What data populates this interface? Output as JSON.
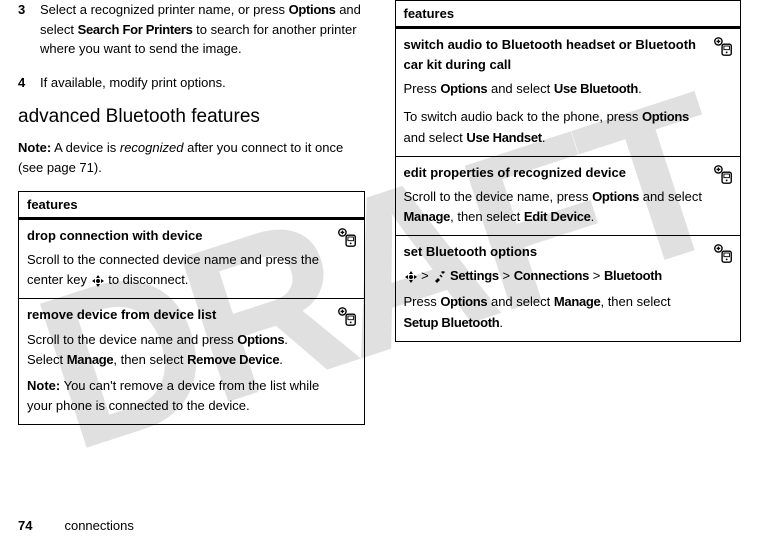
{
  "watermark": "DRAFT",
  "left": {
    "step3_num": "3",
    "step3_a": "Select a recognized printer name, or press ",
    "step3_options": "Options",
    "step3_b": " and select ",
    "step3_search": "Search For Printers",
    "step3_c": " to search for another printer where you want to send the image.",
    "step4_num": "4",
    "step4_text": "If available, modify print options.",
    "heading": "advanced Bluetooth features",
    "note_prefix": "Note:",
    "note_a": " A device is ",
    "note_recognized": "recognized",
    "note_b": " after you connect to it once (see page 71).",
    "features_header": "features",
    "row1_title": "drop connection with device",
    "row1_a": "Scroll to the connected device name and press the center key ",
    "row1_b": " to disconnect.",
    "row2_title": "remove device from device list",
    "row2_a": "Scroll to the device name and press ",
    "row2_options": "Options",
    "row2_b": ". Select ",
    "row2_manage": "Manage",
    "row2_c": ", then select ",
    "row2_remove": "Remove Device",
    "row2_d": ".",
    "row2_note_prefix": "Note:",
    "row2_note": " You can't remove a device from the list while your phone is connected to the device."
  },
  "right": {
    "features_header": "features",
    "r1_title": "switch audio to Bluetooth headset or Bluetooth car kit during call",
    "r1_a": "Press ",
    "r1_options": "Options",
    "r1_b": " and select ",
    "r1_usebt": "Use Bluetooth",
    "r1_c": ".",
    "r1_d": "To switch audio back to the phone, press ",
    "r1_options2": "Options",
    "r1_e": " and select ",
    "r1_usehandset": "Use Handset",
    "r1_f": ".",
    "r2_title": "edit properties of recognized device",
    "r2_a": "Scroll to the device name, press ",
    "r2_options": "Options",
    "r2_b": " and select ",
    "r2_manage": "Manage",
    "r2_c": ", then select ",
    "r2_edit": "Edit Device",
    "r2_d": ".",
    "r3_title": "set Bluetooth options",
    "r3_path_settings": "Settings",
    "r3_gt1": " > ",
    "r3_path_conn": "Connections",
    "r3_gt2": " > ",
    "r3_path_bt": "Bluetooth",
    "r3_a": "Press ",
    "r3_options": "Options",
    "r3_b": " and select ",
    "r3_manage": "Manage",
    "r3_c": ", then select ",
    "r3_setup": "Setup Bluetooth",
    "r3_d": "."
  },
  "footer": {
    "page": "74",
    "section": "connections"
  }
}
